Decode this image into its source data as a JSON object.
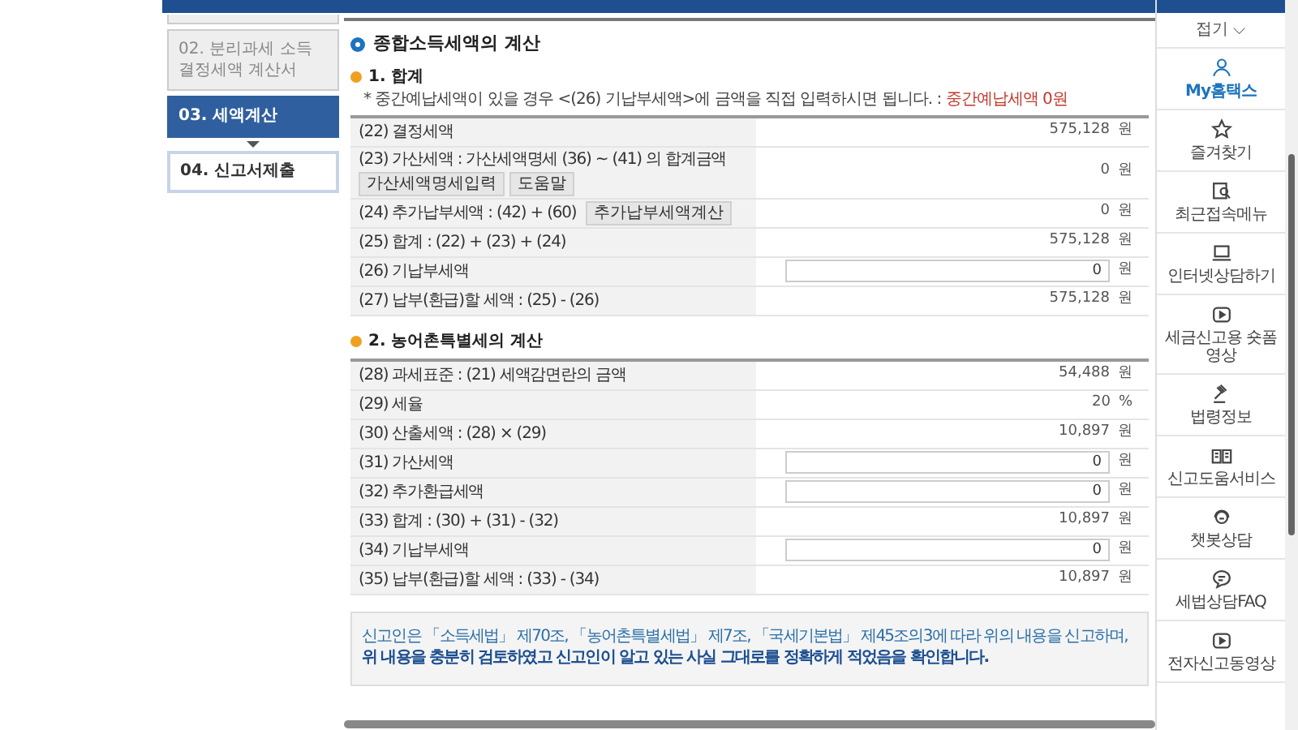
{
  "steps": [
    {
      "label": "02. 분리과세 소득 결정세액 계산서",
      "selected": false
    },
    {
      "label": "03. 세액계산",
      "selected": true
    },
    {
      "label": "04. 신고서제출",
      "selected": false
    }
  ],
  "main": {
    "title": "종합소득세액의 계산",
    "sections": [
      {
        "title": "1. 합계",
        "note": "* 중간예납세액이 있을 경우 <(26) 기납부세액>에 금액을 직접 입력하시면 됩니다. : ",
        "note_highlight": "중간예납세액 0원",
        "rows": [
          {
            "kind": "value",
            "label": "(22) 결정세액",
            "value": "575,128",
            "unit": "원"
          },
          {
            "kind": "value",
            "label": "(23) 가산세액 : 가산세액명세 (36) ~ (41) 의 합계금액",
            "buttons_below": [
              "가산세액명세입력",
              "도움말"
            ],
            "value": "0",
            "unit": "원"
          },
          {
            "kind": "value",
            "label": "(24) 추가납부세액 : (42) + (60)",
            "buttons_inline": [
              "추가납부세액계산"
            ],
            "value": "0",
            "unit": "원"
          },
          {
            "kind": "value",
            "label": "(25) 합계 : (22) + (23) + (24)",
            "value": "575,128",
            "unit": "원"
          },
          {
            "kind": "input",
            "label": "(26) 기납부세액",
            "value": "0",
            "unit": "원"
          },
          {
            "kind": "value",
            "label": "(27) 납부(환급)할 세액 : (25) - (26)",
            "value": "575,128",
            "unit": "원"
          }
        ]
      },
      {
        "title": "2. 농어촌특별세의 계산",
        "rows": [
          {
            "kind": "value",
            "label": "(28) 과세표준 : (21) 세액감면란의 금액",
            "value": "54,488",
            "unit": "원"
          },
          {
            "kind": "value",
            "label": "(29) 세율",
            "value": "20",
            "unit": "%"
          },
          {
            "kind": "value",
            "label": "(30) 산출세액 : (28) × (29)",
            "value": "10,897",
            "unit": "원"
          },
          {
            "kind": "input",
            "label": "(31) 가산세액",
            "value": "0",
            "unit": "원"
          },
          {
            "kind": "input",
            "label": "(32) 추가환급세액",
            "value": "0",
            "unit": "원"
          },
          {
            "kind": "value",
            "label": "(33) 합계 : (30) + (31) - (32)",
            "value": "10,897",
            "unit": "원"
          },
          {
            "kind": "input",
            "label": "(34) 기납부세액",
            "value": "0",
            "unit": "원"
          },
          {
            "kind": "value",
            "label": "(35) 납부(환급)할 세액 : (33) - (34)",
            "value": "10,897",
            "unit": "원"
          }
        ]
      }
    ],
    "declaration": [
      "신고인은 「소득세법」 제70조, 「농어촌특별세법」 제7조, 「국세기본법」 제45조의3에 따라 위의 내용을 신고하며,",
      "위 내용을 충분히 검토하였고 신고인이 알고 있는 사실 그대로를 정확하게 적었음을 확인합니다."
    ]
  },
  "quick_menu": {
    "collapse": "접기 ⌵",
    "items": [
      {
        "kind": "user",
        "label": "My홈택스",
        "selected": true
      },
      {
        "kind": "star",
        "label": "즐겨찾기",
        "selected": false
      },
      {
        "kind": "recent",
        "label": "최근접속메뉴",
        "selected": false
      },
      {
        "kind": "laptop",
        "label": "인터넷상담하기",
        "selected": false
      },
      {
        "kind": "video",
        "label": "세금신고용 숏폼영상",
        "selected": false
      },
      {
        "kind": "law",
        "label": "법령정보",
        "selected": false
      },
      {
        "kind": "guide",
        "label": "신고도움서비스",
        "selected": false
      },
      {
        "kind": "chatbot",
        "label": "챗봇상담",
        "selected": false
      },
      {
        "kind": "faq",
        "label": "세법상담FAQ",
        "selected": false
      },
      {
        "kind": "video",
        "label": "전자신고동영상",
        "selected": false
      }
    ]
  }
}
